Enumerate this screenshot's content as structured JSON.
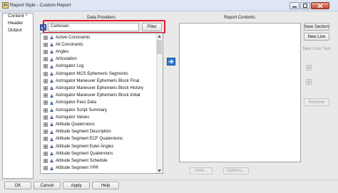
{
  "window": {
    "title": "Report Style - Custom Report"
  },
  "nav": {
    "items": [
      "Content *",
      "Header",
      "Output"
    ]
  },
  "providers": {
    "group_label": "Data Providers",
    "search_value": "Cartesian",
    "filter_label": "Filter",
    "items": [
      "Active Constraints",
      "All Constraints",
      "Angles",
      "Articulation",
      "Astrogator Log",
      "Astrogator MCS Ephemeris Segments",
      "Astrogator Maneuver Ephemeris Block Final",
      "Astrogator Maneuver Ephemeris Block History",
      "Astrogator Maneuver Ephemeris Block Initial",
      "Astrogator Pass Data",
      "Astrogator Script Summary",
      "Astrogator Values",
      "Attitude Quaternions",
      "Attitude Segment Description",
      "Attitude Segment ECF Quaternions",
      "Attitude Segment Euler Angles",
      "Attitude Segment Quaternions",
      "Attitude Segment Schedule",
      "Attitude Segment YPR"
    ]
  },
  "contents": {
    "group_label": "Report Contents",
    "units_label": "Units...",
    "options_label": "Options..."
  },
  "side_buttons": {
    "new_section": "New Section",
    "new_line": "New Line",
    "new_user_text": "New User Text",
    "remove": "Remove"
  },
  "footer": {
    "ok": "OK",
    "cancel": "Cancel",
    "apply": "Apply",
    "help": "Help"
  }
}
